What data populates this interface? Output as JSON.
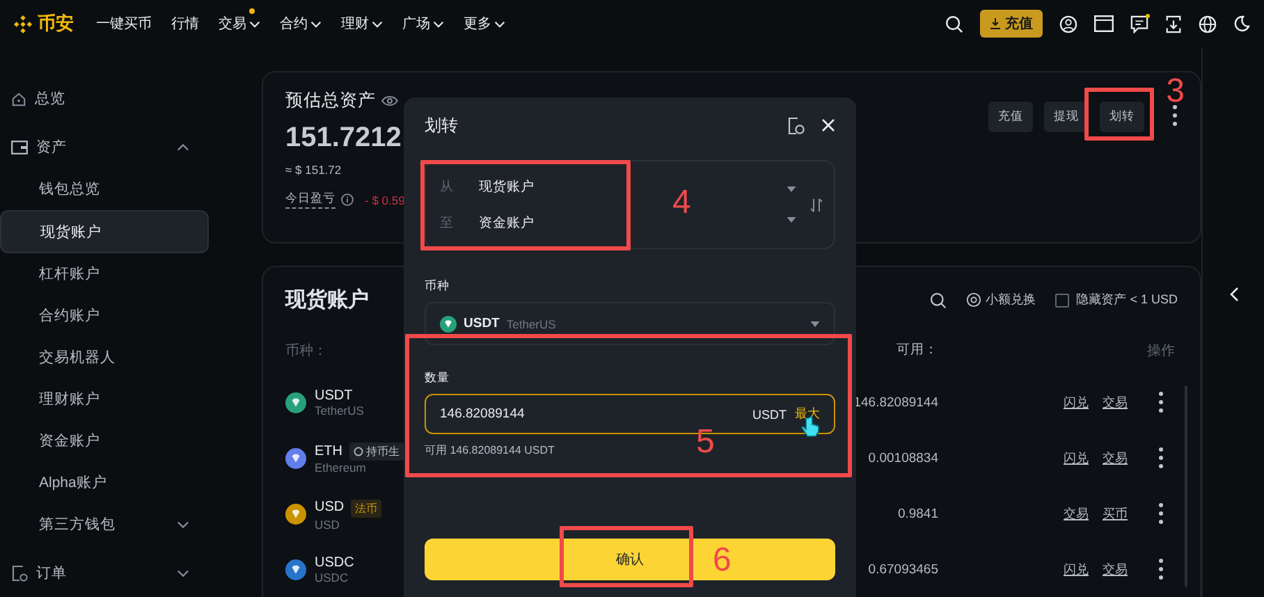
{
  "nav": {
    "logo": "币安",
    "items": [
      {
        "label": "一键买币",
        "dropdown": false,
        "dot": false
      },
      {
        "label": "行情",
        "dropdown": false,
        "dot": false
      },
      {
        "label": "交易",
        "dropdown": true,
        "dot": true
      },
      {
        "label": "合约",
        "dropdown": true,
        "dot": false
      },
      {
        "label": "理财",
        "dropdown": true,
        "dot": false
      },
      {
        "label": "广场",
        "dropdown": true,
        "dot": false
      },
      {
        "label": "更多",
        "dropdown": true,
        "dot": false
      }
    ],
    "deposit_button": "充值",
    "messages_dot": true
  },
  "sidebar": {
    "items": [
      {
        "label": "总览",
        "kind": "home",
        "selected": false
      },
      {
        "label": "资产",
        "kind": "wallet",
        "selected": false,
        "expanded": true,
        "children": [
          {
            "label": "钱包总览",
            "selected": false
          },
          {
            "label": "现货账户",
            "selected": true
          },
          {
            "label": "杠杆账户",
            "selected": false
          },
          {
            "label": "合约账户",
            "selected": false
          },
          {
            "label": "交易机器人",
            "selected": false
          },
          {
            "label": "理财账户",
            "selected": false
          },
          {
            "label": "资金账户",
            "selected": false
          },
          {
            "label": "Alpha账户",
            "selected": false
          },
          {
            "label": "第三方钱包",
            "selected": false,
            "expanded": false
          }
        ]
      },
      {
        "label": "订单",
        "kind": "orders",
        "selected": false,
        "expanded": false
      }
    ]
  },
  "overview": {
    "title": "预估总资产",
    "total": "151.7212",
    "fiat": "≈ $ 151.72",
    "pnl_label": "今日盈亏",
    "pnl_value": "- $ 0.59",
    "buttons": [
      {
        "label": "充值"
      },
      {
        "label": "提现"
      },
      {
        "label": "划转",
        "annotation": "3"
      }
    ]
  },
  "spot": {
    "title": "现货账户",
    "convert_label": "小额兑换",
    "hide_small": {
      "label": "隐藏资产 < 1 USD",
      "checked": false
    },
    "columns": [
      "币种：",
      "可用：",
      "操作"
    ],
    "rows": [
      {
        "symbol": "USDT",
        "name": "TetherUS",
        "color": "#26a17b",
        "tag": null,
        "available": "146.82089144",
        "actions": [
          "闪兑",
          "交易"
        ]
      },
      {
        "symbol": "ETH",
        "name": "Ethereum",
        "color": "#627eea",
        "tag": {
          "kind": "earn",
          "label": "持币生"
        },
        "available": "0.00108834",
        "actions": [
          "闪兑",
          "交易"
        ]
      },
      {
        "symbol": "USD",
        "name": "USD",
        "color": "#c99400",
        "tag": {
          "kind": "fiat",
          "label": "法币"
        },
        "available": "0.9841",
        "actions": [
          "交易",
          "买币"
        ]
      },
      {
        "symbol": "USDC",
        "name": "USDC",
        "color": "#2775ca",
        "tag": null,
        "available": "0.67093465",
        "actions": [
          "闪兑",
          "交易"
        ]
      }
    ]
  },
  "transfer_dialog": {
    "title": "划转",
    "from_to": {
      "annotation": "4",
      "from_label": "从",
      "from": "现货账户",
      "to_label": "至",
      "to": "资金账户"
    },
    "coin": {
      "label": "币种",
      "symbol": "USDT",
      "name": "TetherUS"
    },
    "amount": {
      "annotation": "5",
      "label": "数量",
      "value": "146.82089144",
      "unit": "USDT",
      "max": "最大",
      "available": "可用 146.82089144 USDT"
    },
    "confirm": {
      "label": "确认",
      "annotation": "6"
    }
  }
}
